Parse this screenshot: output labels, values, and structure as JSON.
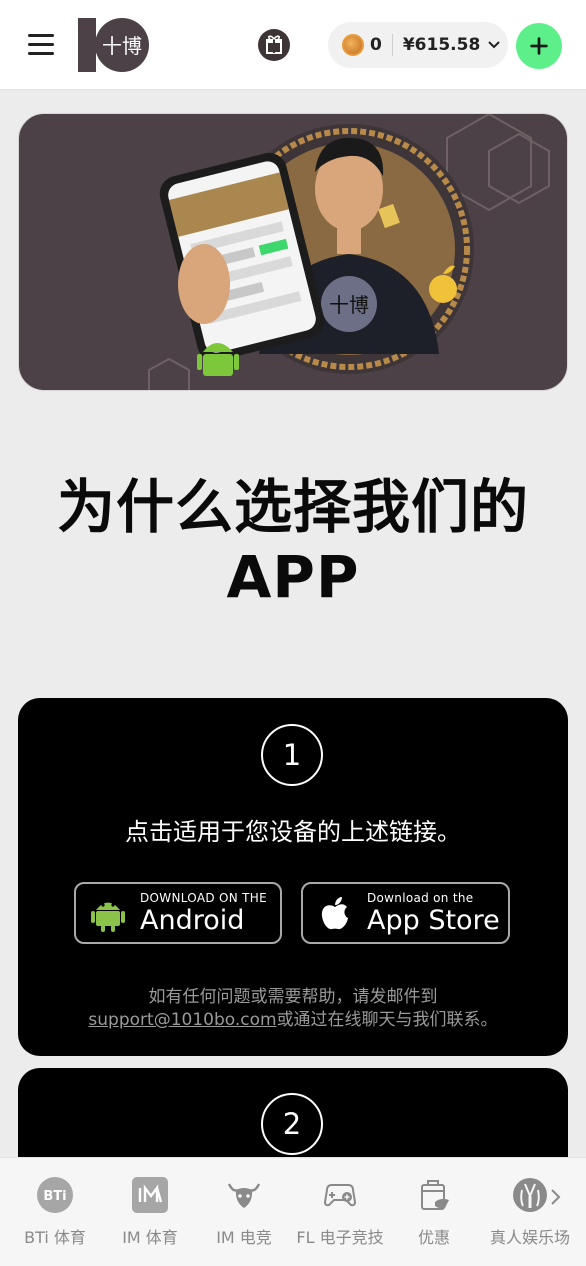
{
  "header": {
    "logo_text": "十博",
    "coin_count": "0",
    "balance": "¥615.58"
  },
  "banner": {
    "brand_mark": "十博"
  },
  "main": {
    "title_line1": "为什么选择我们的",
    "title_line2": "APP"
  },
  "steps": [
    {
      "number": "1",
      "text": "点击适用于您设备的上述链接。",
      "android": {
        "small": "DOWNLOAD ON THE",
        "big": "Android"
      },
      "apple": {
        "small": "Download on the",
        "big": "App Store"
      },
      "help_line1": "如有任何问题或需要帮助，请发邮件到",
      "help_email": "support@1010bo.com",
      "help_line2_rest": "或通过在线聊天与我们联系。"
    },
    {
      "number": "2"
    }
  ],
  "bottom_nav": [
    {
      "label": "BTi 体育",
      "icon": "bti-icon"
    },
    {
      "label": "IM 体育",
      "icon": "im-sports-icon"
    },
    {
      "label": "IM 电竞",
      "icon": "bull-icon"
    },
    {
      "label": "FL 电子竞技",
      "icon": "gamepad-icon"
    },
    {
      "label": "优惠",
      "icon": "promo-icon"
    },
    {
      "label": "真人娱乐场",
      "icon": "live-casino-icon"
    }
  ],
  "colors": {
    "accent_green": "#5df08a",
    "banner_bg": "#4b4146",
    "card_bg": "#000000"
  }
}
